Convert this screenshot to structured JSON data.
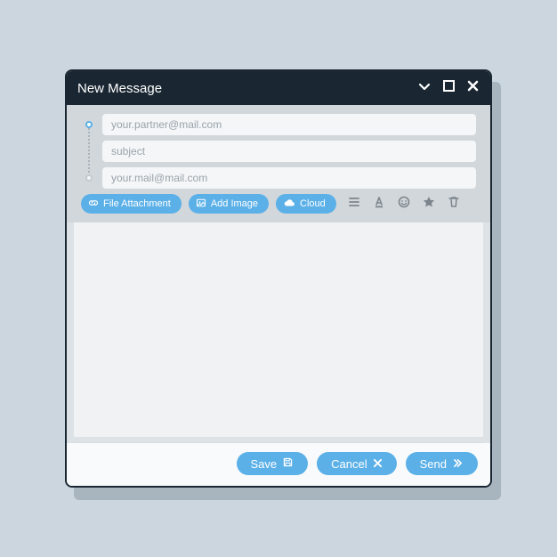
{
  "window": {
    "title": "New Message"
  },
  "fields": {
    "to_placeholder": "your.partner@mail.com",
    "subject_placeholder": "subject",
    "from_placeholder": "your.mail@mail.com"
  },
  "toolbar": {
    "attach_label": "File Attachment",
    "image_label": "Add Image",
    "cloud_label": "Cloud"
  },
  "footer": {
    "save_label": "Save",
    "cancel_label": "Cancel",
    "send_label": "Send"
  },
  "colors": {
    "accent": "#5bb0e8",
    "titlebar": "#1a2733"
  }
}
